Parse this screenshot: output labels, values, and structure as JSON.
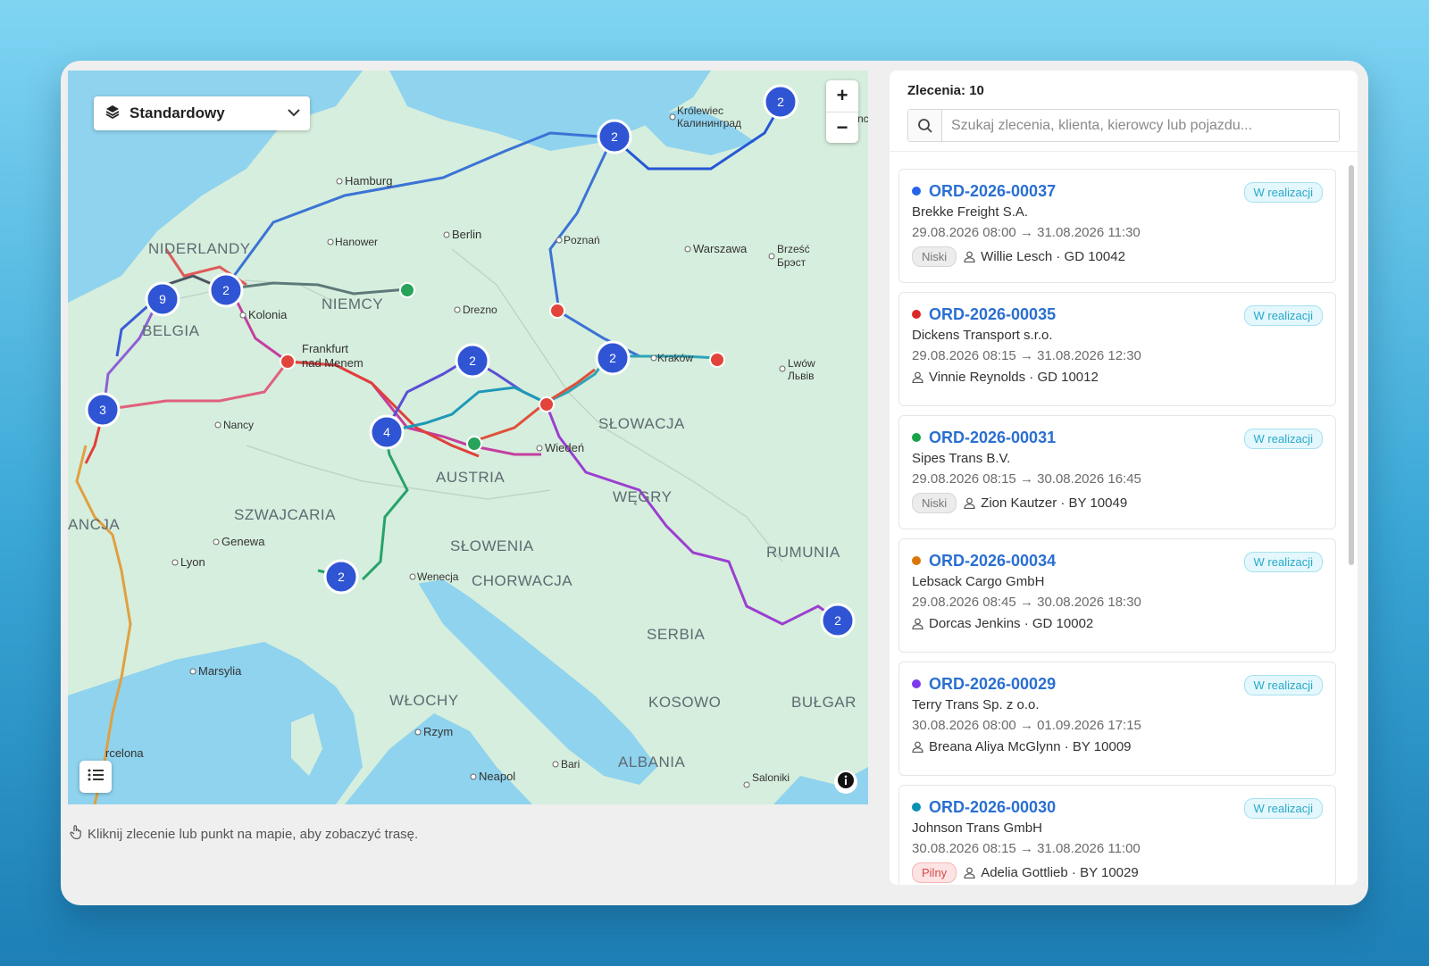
{
  "map": {
    "layer_label": "Standardowy",
    "zoom_in": "+",
    "zoom_out": "−",
    "countries": [
      "NIDERLANDY",
      "BELGIA",
      "NIEMCY",
      "AUSTRIA",
      "SZWAJCARIA",
      "SŁOWACJA",
      "WĘGRY",
      "SŁOWENIA",
      "CHORWACJA",
      "RUMUNIA",
      "SERBIA",
      "KOSOWO",
      "ALBANIA",
      "WŁOCHY",
      "BUŁGAR",
      "ANCJA"
    ],
    "cities": [
      "Hamburg",
      "Hanower",
      "Berlin",
      "Poznań",
      "Warszawa",
      "Brześć",
      "Брэст",
      "Królewiec",
      "Калининград",
      "Kolonia",
      "Frankfurt",
      "nad Menem",
      "Drezno",
      "Kraków",
      "Lwów",
      "Львів",
      "Nancy",
      "Wiedeń",
      "Genewa",
      "Lyon",
      "Wenecja",
      "Marsylia",
      "Rzym",
      "rcelona",
      "Bari",
      "Neapol",
      "Saloniki",
      "nc"
    ],
    "clusters": [
      "2",
      "2",
      "9",
      "2",
      "2",
      "2",
      "3",
      "4",
      "2",
      "2"
    ]
  },
  "hint": "Kliknij zlecenie lub punkt na mapie, aby zobaczyć trasę.",
  "panel": {
    "count": "Zlecenia: 10",
    "search_placeholder": "Szukaj zlecenia, klienta, kierowcy lub pojazdu...",
    "orders": [
      {
        "id": "ORD-2026-00037",
        "color": "#2563eb",
        "status": "W realizacji",
        "client": "Brekke Freight S.A.",
        "dates": "29.08.2026 08:00 → 31.08.2026 11:30",
        "priority": "Niski",
        "driver": "Willie Lesch · GD 10042"
      },
      {
        "id": "ORD-2026-00035",
        "color": "#dc2626",
        "status": "W realizacji",
        "client": "Dickens Transport s.r.o.",
        "dates": "29.08.2026 08:15 → 31.08.2026 12:30",
        "priority": "",
        "driver": "Vinnie Reynolds · GD 10012"
      },
      {
        "id": "ORD-2026-00031",
        "color": "#16a34a",
        "status": "W realizacji",
        "client": "Sipes Trans B.V.",
        "dates": "29.08.2026 08:15 → 30.08.2026 16:45",
        "priority": "Niski",
        "driver": "Zion Kautzer · BY 10049"
      },
      {
        "id": "ORD-2026-00034",
        "color": "#d97706",
        "status": "W realizacji",
        "client": "Lebsack Cargo GmbH",
        "dates": "29.08.2026 08:45 → 30.08.2026 18:30",
        "priority": "",
        "driver": "Dorcas Jenkins · GD 10002"
      },
      {
        "id": "ORD-2026-00029",
        "color": "#7c3aed",
        "status": "W realizacji",
        "client": "Terry Trans Sp. z o.o.",
        "dates": "30.08.2026 08:00 → 01.09.2026 17:15",
        "priority": "",
        "driver": "Breana Aliya McGlynn · BY 10009"
      },
      {
        "id": "ORD-2026-00030",
        "color": "#0891b2",
        "status": "W realizacji",
        "client": "Johnson Trans GmbH",
        "dates": "30.08.2026 08:15 → 31.08.2026 11:00",
        "priority": "Pilny",
        "driver": "Adelia Gottlieb · BY 10029"
      }
    ]
  },
  "colors": {
    "water": "#8fd3ee",
    "land": "#d6eedd",
    "cluster": "#2f55d4",
    "order_link": "#2a6fd1"
  }
}
